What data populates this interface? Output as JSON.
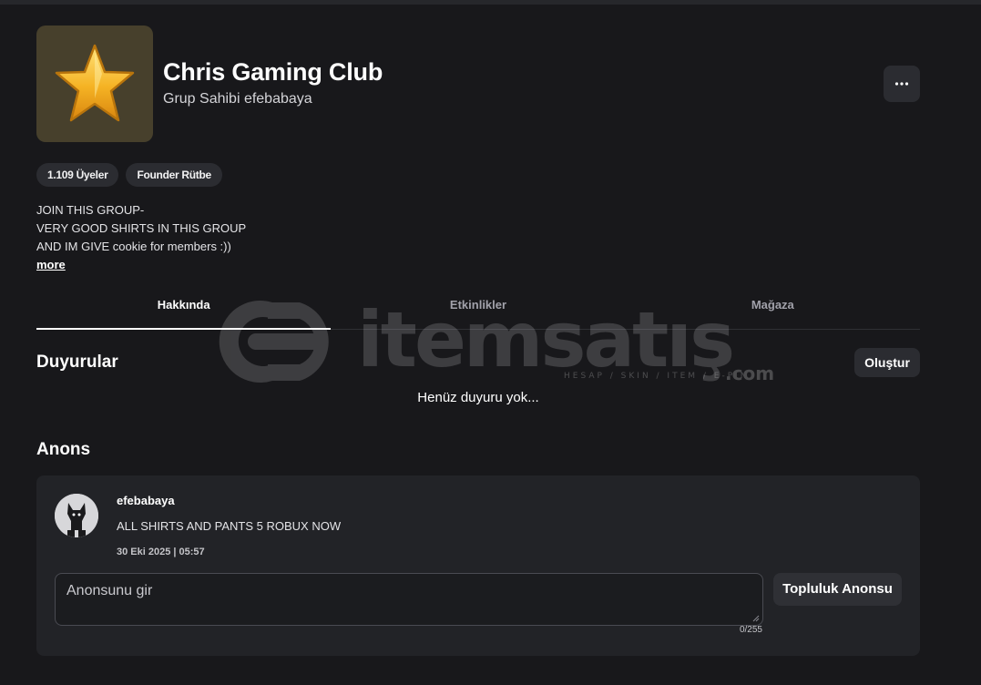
{
  "group": {
    "name": "Chris Gaming Club",
    "owner_line": "Grup Sahibi efebabaya",
    "icon": "star-icon",
    "icon_bg": "#47402c"
  },
  "badges": [
    "1.109 Üyeler",
    "Founder Rütbe"
  ],
  "description": {
    "lines": [
      "JOIN THIS GROUP-",
      "VERY GOOD SHIRTS IN THIS GROUP",
      "AND IM GIVE cookie for members :))"
    ],
    "more_label": "more"
  },
  "tabs": [
    {
      "label": "Hakkında",
      "active": true
    },
    {
      "label": "Etkinlikler",
      "active": false
    },
    {
      "label": "Mağaza",
      "active": false
    }
  ],
  "announcements": {
    "title": "Duyurular",
    "create_label": "Oluştur",
    "empty_text": "Henüz duyuru yok..."
  },
  "shout": {
    "title": "Anons",
    "post": {
      "user": "efebabaya",
      "body": "ALL SHIRTS AND PANTS 5 ROBUX NOW",
      "time": "30 Eki 2025 | 05:57"
    },
    "input_placeholder": "Anonsunu gir",
    "counter": "0/255",
    "post_button": "Topluluk Anonsu"
  },
  "watermark": {
    "text": "itemsatış",
    "tagline": "HESAP / SKIN / ITEM / E-PIN",
    "suffix": ".com"
  },
  "colors": {
    "background": "#18181b",
    "surface": "#222327",
    "button": "#2b2c31",
    "accent_star": "#f5b324"
  }
}
